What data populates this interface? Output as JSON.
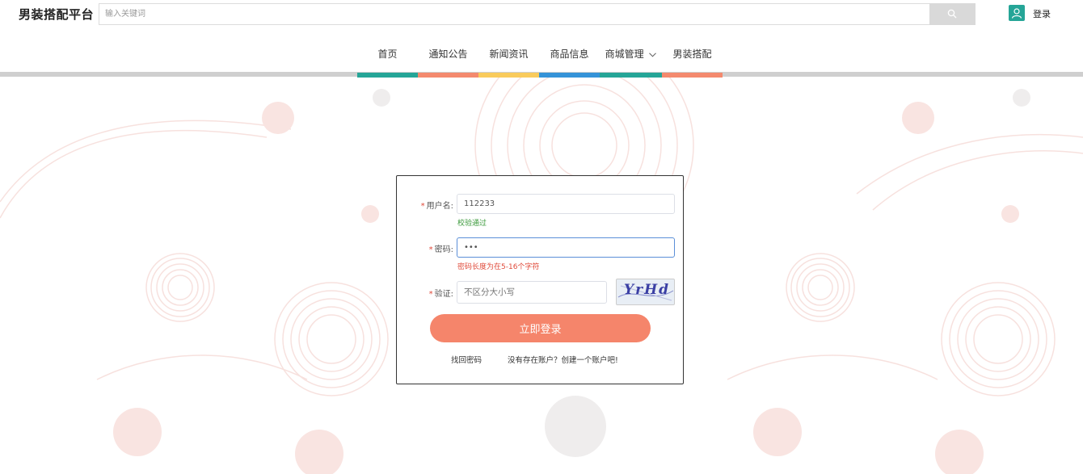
{
  "header": {
    "site_title": "男装搭配平台",
    "search_placeholder": "输入关键词",
    "login_label": "登录"
  },
  "nav": {
    "items": [
      {
        "label": "首页",
        "color": "#25a597"
      },
      {
        "label": "通知公告",
        "color": "#f48a6e"
      },
      {
        "label": "新闻资讯",
        "color": "#f9cb5c"
      },
      {
        "label": "商品信息",
        "color": "#3593d8"
      },
      {
        "label": "商城管理",
        "color": "#25a597",
        "has_dropdown": true
      },
      {
        "label": "男装搭配",
        "color": "#f48a6e"
      }
    ]
  },
  "login_form": {
    "username_label": "用户名:",
    "username_value": "112233",
    "username_hint": "校验通过",
    "password_label": "密码:",
    "password_value": "•••",
    "password_hint": "密码长度为在5-16个字符",
    "captcha_label": "验证:",
    "captcha_placeholder": "不区分大小写",
    "captcha_text": "YrHd",
    "submit_label": "立即登录",
    "forgot_link": "找回密码",
    "register_link": "没有存在账户？创建一个账户吧!",
    "colors": {
      "success": "#3c9a3c",
      "error": "#e04a3a",
      "submit": "#f5856b"
    }
  }
}
